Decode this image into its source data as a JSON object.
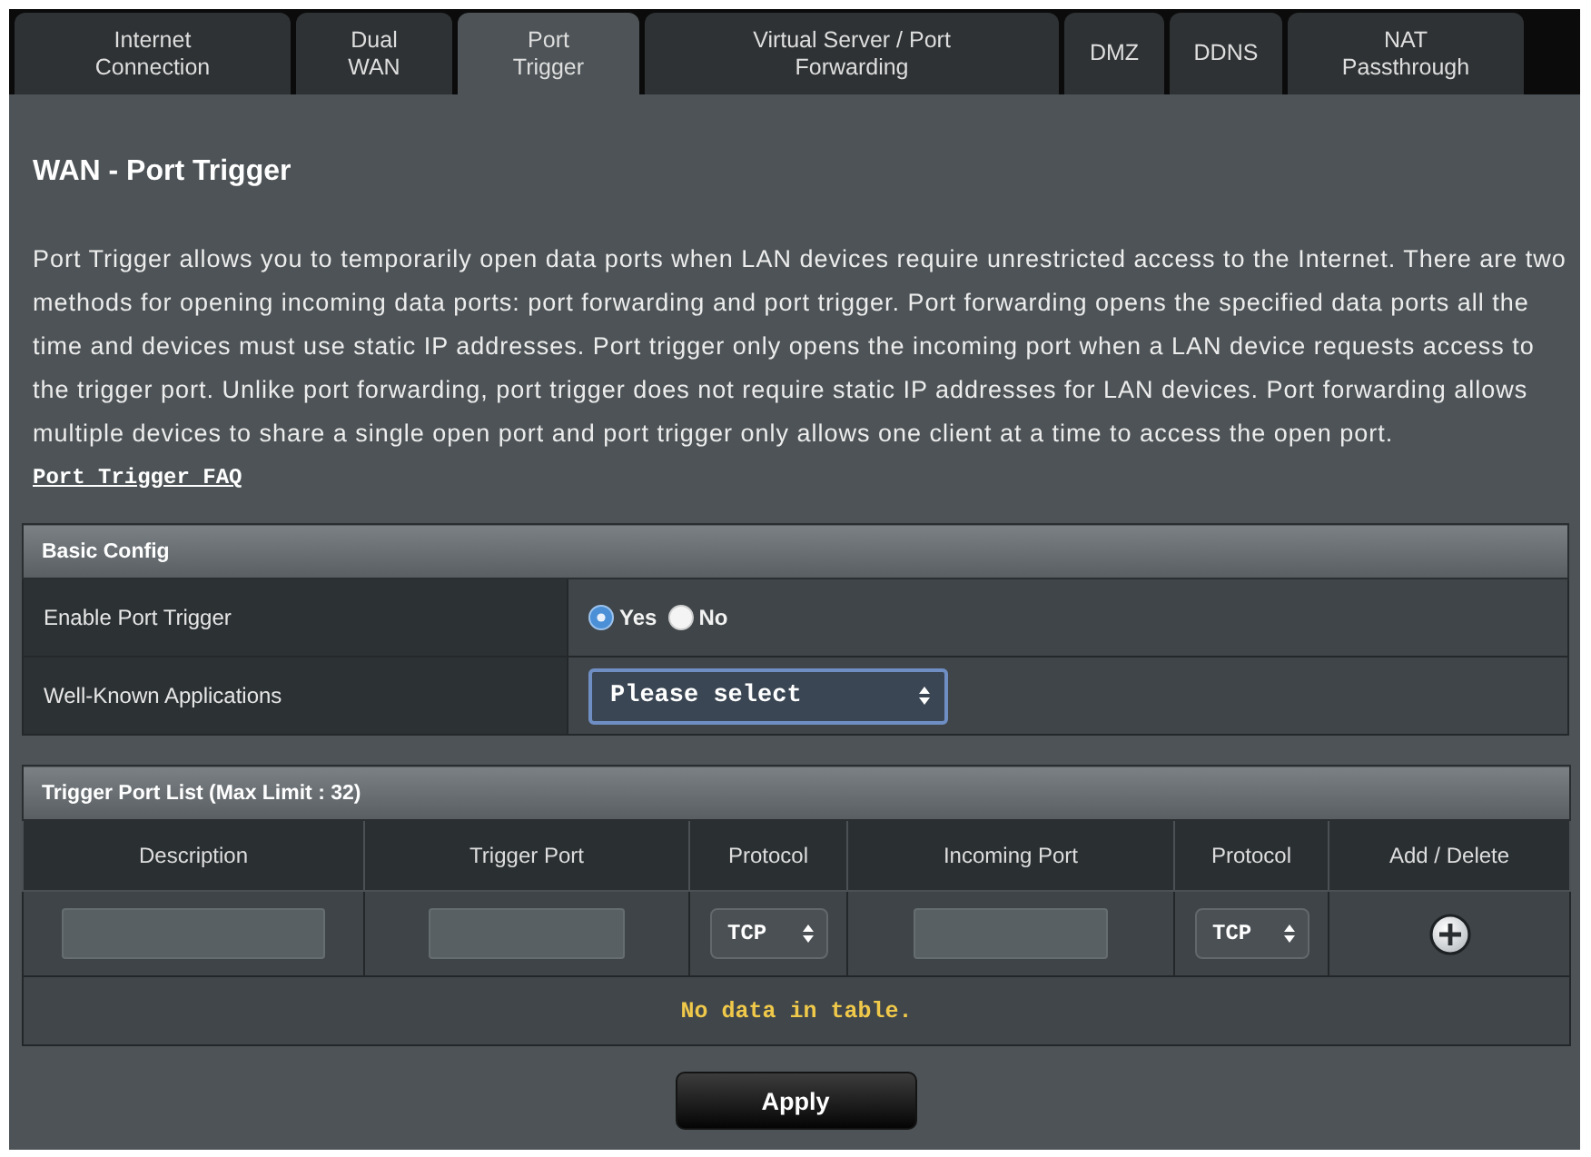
{
  "tabs": [
    {
      "label": "Internet\nConnection",
      "selected": false
    },
    {
      "label": "Dual\nWAN",
      "selected": false
    },
    {
      "label": "Port\nTrigger",
      "selected": true
    },
    {
      "label": "Virtual Server / Port\nForwarding",
      "selected": false
    },
    {
      "label": "DMZ",
      "selected": false
    },
    {
      "label": "DDNS",
      "selected": false
    },
    {
      "label": "NAT\nPassthrough",
      "selected": false
    }
  ],
  "page_title": "WAN - Port Trigger",
  "description": "Port Trigger allows you to temporarily open data ports when LAN devices require unrestricted access to the Internet. There are two methods for opening incoming data ports: port forwarding and port trigger. Port forwarding opens the specified data ports all the time and devices must use static IP addresses. Port trigger only opens the incoming port when a LAN device requests access to the trigger port. Unlike port forwarding, port trigger does not require static IP addresses for LAN devices. Port forwarding allows multiple devices to share a single open port and port trigger only allows one client at a time to access the open port.",
  "faq_link": "Port Trigger FAQ",
  "basic_config": {
    "title": "Basic Config",
    "rows": [
      {
        "kind": "radio",
        "label": "Enable Port Trigger",
        "options": [
          {
            "label": "Yes",
            "selected": true
          },
          {
            "label": "No",
            "selected": false
          }
        ]
      },
      {
        "kind": "select",
        "label": "Well-Known Applications",
        "value": "Please select"
      }
    ]
  },
  "trigger_port_list": {
    "title": "Trigger Port List (Max Limit : 32)",
    "columns": [
      "Description",
      "Trigger Port",
      "Protocol",
      "Incoming Port",
      "Protocol",
      "Add / Delete"
    ],
    "input_row": [
      {
        "kind": "input"
      },
      {
        "kind": "input"
      },
      {
        "kind": "select",
        "value": "TCP"
      },
      {
        "kind": "input"
      },
      {
        "kind": "select",
        "value": "TCP"
      },
      {
        "kind": "add"
      }
    ],
    "empty_message": "No data in table."
  },
  "apply_button": "Apply"
}
